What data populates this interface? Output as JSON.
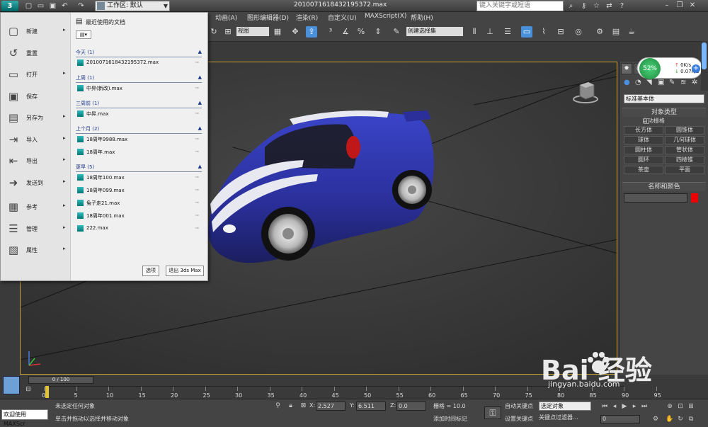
{
  "window": {
    "title": "2010071618432195372.max",
    "workspace": "工作区: 默认",
    "search_placeholder": "键入关键字或短语"
  },
  "menubar": [
    "动画(A)",
    "图形编辑器(D)",
    "渲染(R)",
    "自定义(U)",
    "MAXScript(X)",
    "帮助(H)"
  ],
  "toolbar": {
    "view_select": "视图",
    "selection_set": "创建选择集"
  },
  "app_menu": {
    "left_items": [
      {
        "label": "新建",
        "icon": "new-icon",
        "arrow": true
      },
      {
        "label": "重置",
        "icon": "reset-icon",
        "arrow": false
      },
      {
        "label": "打开",
        "icon": "open-icon",
        "arrow": true
      },
      {
        "label": "保存",
        "icon": "save-icon",
        "arrow": false
      },
      {
        "label": "另存为",
        "icon": "save-as-icon",
        "arrow": true
      },
      {
        "label": "导入",
        "icon": "import-icon",
        "arrow": true
      },
      {
        "label": "导出",
        "icon": "export-icon",
        "arrow": true
      },
      {
        "label": "发送到",
        "icon": "send-to-icon",
        "arrow": true
      },
      {
        "label": "参考",
        "icon": "reference-icon",
        "arrow": true
      },
      {
        "label": "管理",
        "icon": "manage-icon",
        "arrow": true
      },
      {
        "label": "属性",
        "icon": "properties-icon",
        "arrow": true
      }
    ],
    "recent_title": "最近使用的文档",
    "groups": [
      {
        "title": "今天 (1)",
        "files": [
          "2010071618432195372.max"
        ]
      },
      {
        "title": "上周 (1)",
        "files": [
          "中昇(新改).max"
        ]
      },
      {
        "title": "三周前 (1)",
        "files": [
          "中昇.max"
        ]
      },
      {
        "title": "上个月 (2)",
        "files": [
          "18周年9988.max",
          "18周年.max"
        ]
      },
      {
        "title": "更早 (5)",
        "files": [
          "18周年100.max",
          "18周年099.max",
          "兔子走21.max",
          "18周年001.max",
          "222.max"
        ]
      }
    ],
    "options_button": "选项",
    "exit_button": "退出 3ds Max"
  },
  "net_monitor": {
    "percent": "52%",
    "up": "0K/s",
    "down": "0.07K/s"
  },
  "command_panel": {
    "category": "标准基本体",
    "rollout_object_type": "对象类型",
    "autogrid": "自动栅格",
    "object_buttons": [
      "长方体",
      "圆锥体",
      "球体",
      "几何球体",
      "圆柱体",
      "管状体",
      "圆环",
      "四棱锥",
      "茶壶",
      "平面"
    ],
    "rollout_name_color": "名称和颜色",
    "object_color": "#ee0000"
  },
  "timeline": {
    "slider": "0 / 100",
    "ticks": [
      "0",
      "5",
      "10",
      "15",
      "20",
      "25",
      "30",
      "35",
      "40",
      "45",
      "50",
      "55",
      "60",
      "65",
      "70",
      "75",
      "80",
      "85",
      "90",
      "95"
    ]
  },
  "status": {
    "maxscript": "欢迎使用 MAXScr",
    "line1": "未选定任何对象",
    "line2": "单击并拖动以选择并移动对象",
    "x_label": "X:",
    "x_value": "2.527",
    "y_label": "Y:",
    "y_value": "6.511",
    "z_label": "Z:",
    "z_value": "0.0",
    "grid": "栅格 = 10.0",
    "add_time_tag": "添加时间标记",
    "auto_key": "自动关键点",
    "set_key": "设置关键点",
    "selection_dropdown": "选定对象",
    "key_filters": "关键点过滤器...",
    "frame": "0"
  },
  "watermark": {
    "text": "Bai  经验",
    "sub": "jingyan.baidu.com"
  }
}
